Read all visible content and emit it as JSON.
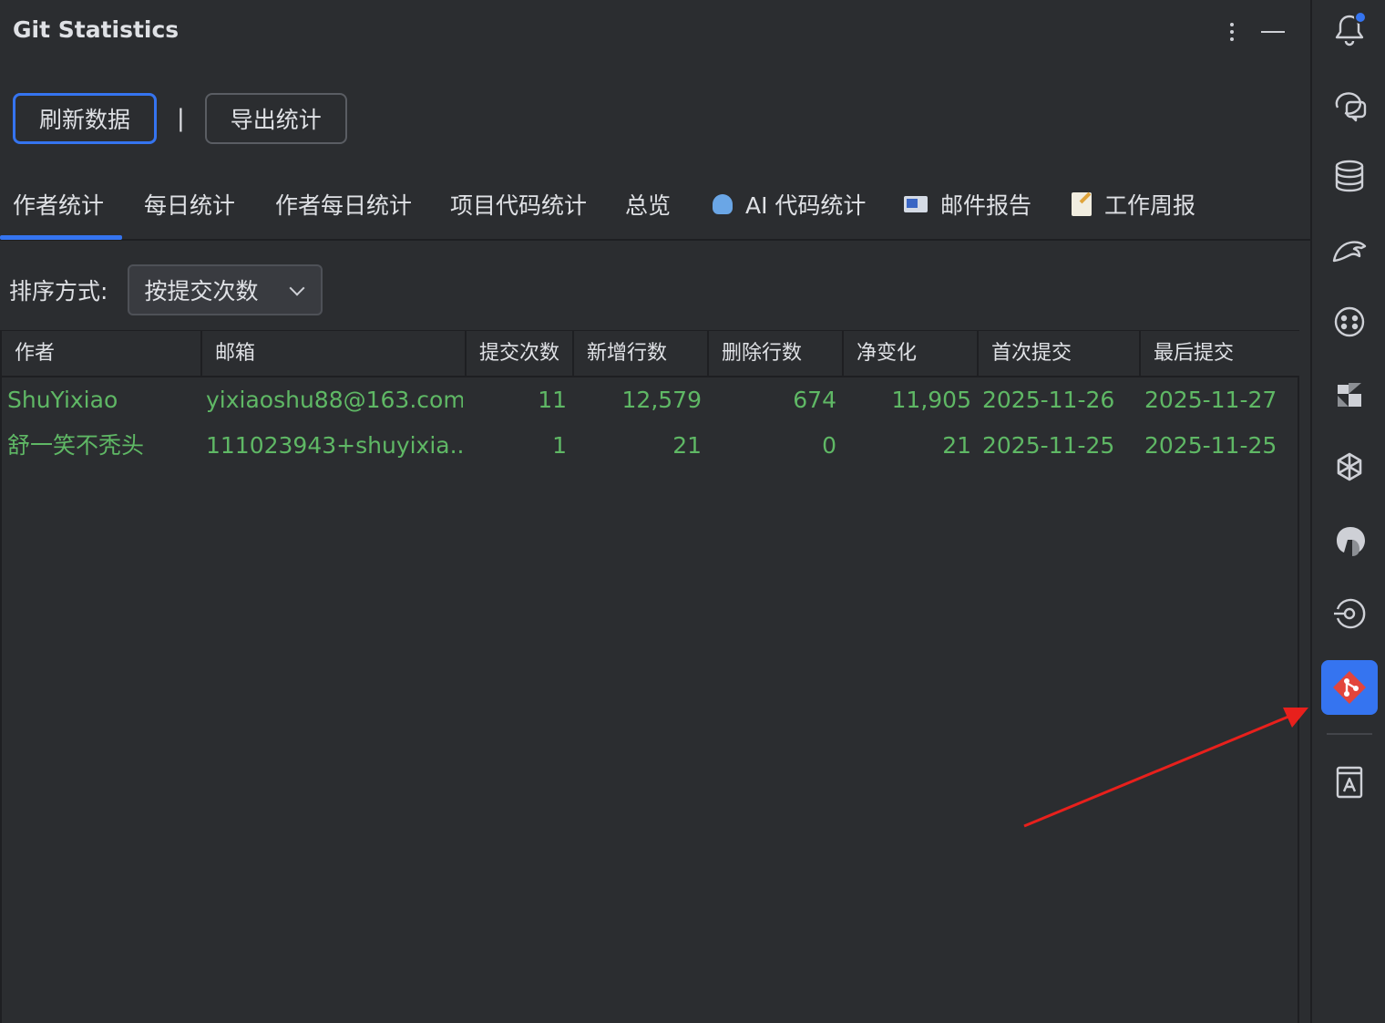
{
  "panel": {
    "title": "Git Statistics"
  },
  "toolbar": {
    "refresh_label": "刷新数据",
    "separator": "|",
    "export_label": "导出统计"
  },
  "tabs": [
    {
      "label": "作者统计",
      "active": true
    },
    {
      "label": "每日统计"
    },
    {
      "label": "作者每日统计"
    },
    {
      "label": "项目代码统计"
    },
    {
      "label": "总览"
    },
    {
      "label": "AI 代码统计",
      "icon": "robot-icon"
    },
    {
      "label": "邮件报告",
      "icon": "mail-icon"
    },
    {
      "label": "工作周报",
      "icon": "memo-icon"
    }
  ],
  "sort": {
    "label": "排序方式:",
    "selected": "按提交次数"
  },
  "table": {
    "headers": [
      "作者",
      "邮箱",
      "提交次数",
      "新增行数",
      "删除行数",
      "净变化",
      "首次提交",
      "最后提交"
    ],
    "rows": [
      [
        "ShuYixiao",
        "yixiaoshu88@163.com",
        "11",
        "12,579",
        "674",
        "11,905",
        "2025-11-26",
        "2025-11-27"
      ],
      [
        "舒一笑不秃头",
        "111023943+shuyixia...",
        "1",
        "21",
        "0",
        "21",
        "2025-11-25",
        "2025-11-25"
      ]
    ]
  },
  "sidebar": {
    "icons": [
      "bell-icon",
      "chat-icon",
      "database-icon",
      "dolphin-icon",
      "bot-face-icon",
      "jetbrains-ai-icon",
      "openai-icon",
      "claude-icon",
      "run-target-icon",
      "git-statistics-icon",
      "translate-book-icon"
    ],
    "active": "git-statistics-icon"
  },
  "colors": {
    "accent": "#3574f0",
    "row_text": "#5fb865",
    "annotation_arrow": "#e8201c"
  }
}
